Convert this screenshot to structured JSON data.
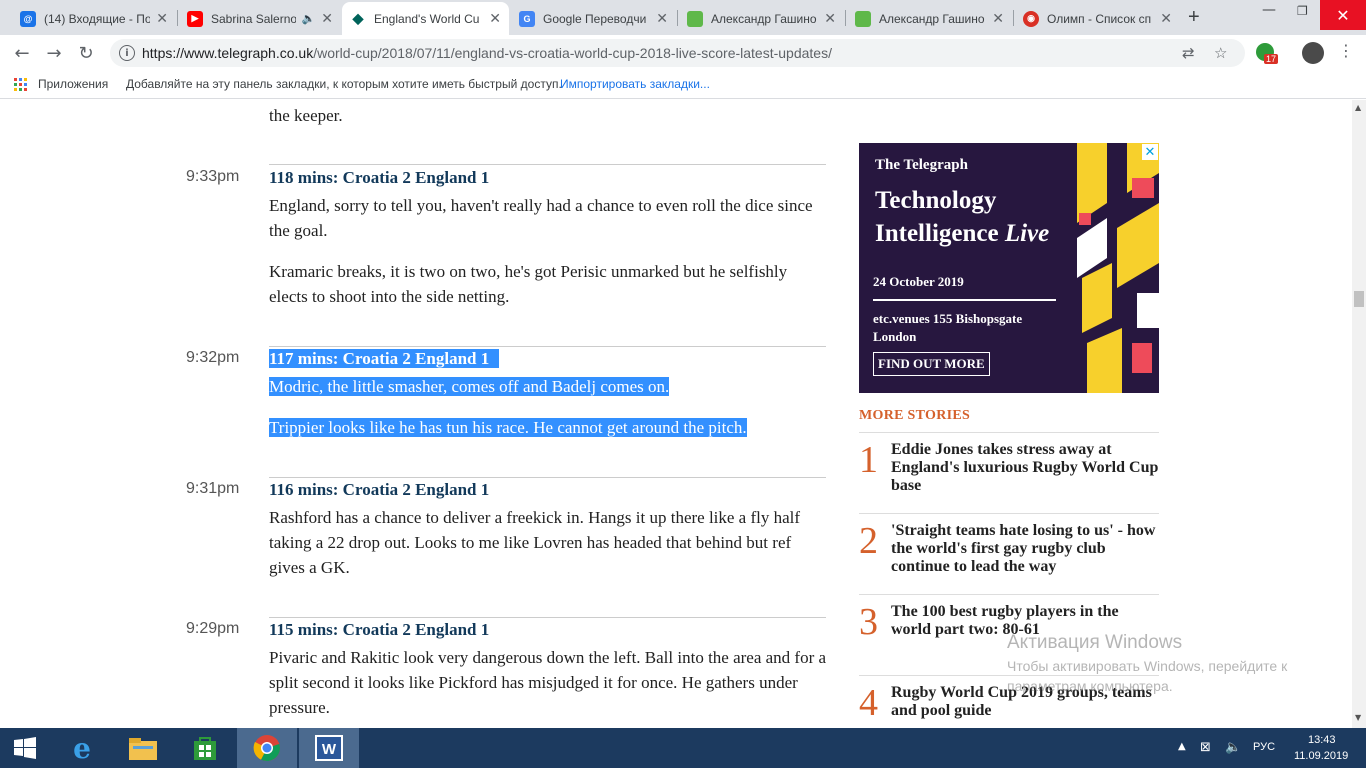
{
  "browser": {
    "tabs": [
      {
        "title": "(14) Входящие - По",
        "icon": "mail-icon",
        "color": "#1a73e8"
      },
      {
        "title": "Sabrina Salerno",
        "icon": "youtube-icon",
        "color": "#ff0000",
        "muted": true
      },
      {
        "title": "England's World Cu",
        "icon": "telegraph-icon",
        "color": "#00635a",
        "active": true
      },
      {
        "title": "Google Переводчи",
        "icon": "translate-icon",
        "color": "#4285f4"
      },
      {
        "title": "Александр Гашино",
        "icon": "green-square-icon",
        "color": "#5fb84a"
      },
      {
        "title": "Александр Гашино",
        "icon": "green-square-icon",
        "color": "#5fb84a"
      },
      {
        "title": "Олимп - Список сп",
        "icon": "olimp-icon",
        "color": "#d93025"
      }
    ],
    "url_host": "https://www.telegraph.co.uk",
    "url_path": "/world-cup/2018/07/11/england-vs-croatia-world-cup-2018-live-score-latest-updates/",
    "extension_badge": "17",
    "bookmarks": {
      "apps_label": "Приложения",
      "hint": "Добавляйте на эту панель закладки, к которым хотите иметь быстрый доступ.",
      "import_link": "Импортировать закладки..."
    }
  },
  "live_blog": {
    "top_fragment": "the keeper.",
    "posts": [
      {
        "time": "9:33pm",
        "heading": "118 mins: Croatia 2 England 1",
        "paragraphs": [
          "England, sorry to tell you, haven't really had a chance to even roll the dice since the goal.",
          "Kramaric breaks, it is two on two, he's got Perisic unmarked but he selfishly elects to shoot into the side netting."
        ]
      },
      {
        "time": "9:32pm",
        "heading": "117 mins: Croatia 2 England 1",
        "selected": true,
        "paragraphs": [
          "Modric, the little smasher, comes off and Badelj comes on.",
          "Trippier looks like he has tun his race. He cannot get around the pitch."
        ]
      },
      {
        "time": "9:31pm",
        "heading": "116 mins: Croatia 2 England 1",
        "paragraphs": [
          "Rashford has a chance to deliver a freekick in. Hangs it up there like a fly half taking a 22 drop out. Looks to me like Lovren has headed that behind but ref gives a GK."
        ]
      },
      {
        "time": "9:29pm",
        "heading": "115 mins: Croatia 2 England 1",
        "paragraphs": [
          "Pivaric and Rakitic look very dangerous down the left. Ball into the area and for a split second it looks like Pickford has misjudged it for once. He gathers under pressure."
        ]
      }
    ]
  },
  "ad": {
    "brand": "The Telegraph",
    "title_line1": "Technology",
    "title_line2_a": "Intelligence ",
    "title_line2_b": "Live",
    "date": "24 October 2019",
    "venue_line1": "etc.venues 155 Bishopsgate",
    "venue_line2": "London",
    "cta": "FIND OUT MORE",
    "close": "✕"
  },
  "more_stories": {
    "heading": "MORE STORIES",
    "items": [
      {
        "num": "1",
        "title": "Eddie Jones takes stress away at England's luxurious Rugby World Cup base"
      },
      {
        "num": "2",
        "title": "'Straight teams hate losing to us' - how the world's first gay rugby club continue to lead the way"
      },
      {
        "num": "3",
        "title": "The 100 best rugby players in the world part two: 80-61"
      },
      {
        "num": "4",
        "title": "Rugby World Cup 2019 groups, teams and pool guide"
      }
    ]
  },
  "watermark": {
    "line1": "Активация Windows",
    "line2": "Чтобы активировать Windows, перейдите к",
    "line3": "параметрам компьютера."
  },
  "taskbar": {
    "apps": [
      "windows-start-icon",
      "internet-explorer-icon",
      "file-explorer-icon",
      "store-icon",
      "chrome-icon",
      "word-icon"
    ],
    "lang": "РУС",
    "time": "13:43",
    "date": "11.09.2019"
  }
}
